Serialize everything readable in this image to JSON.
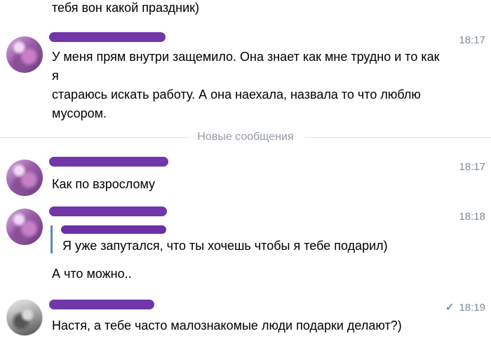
{
  "conversation": {
    "previous_tail": "тебя вон какой праздник)",
    "divider_label": "Новые сообщения",
    "messages": [
      {
        "time": "18:17",
        "lines": [
          "У меня прям внутри защемило. Она знает как мне трудно и то как я",
          "стараюсь искать работу. А она наехала, назвала то что люблю",
          "мусором."
        ]
      },
      {
        "time": "18:17",
        "lines": [
          "Как по взрослому"
        ]
      },
      {
        "time": "18:18",
        "quote": "Я уже запутался, что ты хочешь чтобы я тебе подарил)",
        "lines": [
          "А что можно.."
        ]
      },
      {
        "time": "18:19",
        "read_icon": "checkmark-icon",
        "lines": [
          "Настя, а тебе часто малознакомые люди подарки делают?)"
        ]
      }
    ]
  },
  "colors": {
    "accent": "#4a76a8",
    "timestamp": "#818c99",
    "redaction": "#6b2fa6",
    "quote_bar": "#5c88bd"
  }
}
